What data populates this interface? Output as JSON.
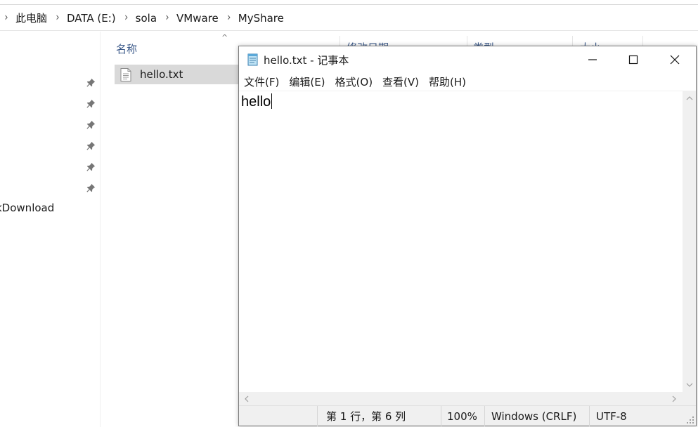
{
  "explorer": {
    "breadcrumb": [
      "此电脑",
      "DATA (E:)",
      "sola",
      "VMware",
      "MyShare"
    ],
    "nav_partial_item": "kDownload",
    "columns": {
      "name": "名称",
      "modified_partial": "修改日期",
      "type_partial": "类型",
      "size_partial": "大小"
    },
    "files": [
      {
        "name": "hello.txt"
      }
    ],
    "pin_count": 6
  },
  "notepad": {
    "title": "hello.txt - 记事本",
    "menu": [
      "文件(F)",
      "编辑(E)",
      "格式(O)",
      "查看(V)",
      "帮助(H)"
    ],
    "content": "hello",
    "status": {
      "position": "第 1 行，第 6 列",
      "zoom": "100%",
      "line_ending": "Windows (CRLF)",
      "encoding": "UTF-8"
    },
    "controls": {
      "minimize": "minimize-icon",
      "maximize": "maximize-icon",
      "close": "close-icon"
    }
  },
  "colors": {
    "selection": "#d9d9d9",
    "column_header": "#3c5a8a",
    "scroll_bg": "#f0f0f0"
  }
}
